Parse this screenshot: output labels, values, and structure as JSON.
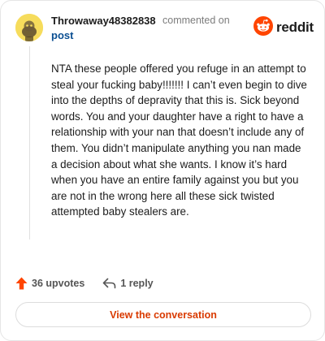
{
  "comment": {
    "author": "Throwaway48382838",
    "action_text": "commented on",
    "target_link": "post",
    "body": "NTA these people offered you refuge in an attempt to steal your fucking baby!!!!!!! I can’t even begin to dive into the depths of depravity that this is. Sick beyond words. You and your daughter have a right to have a relationship with your nan that doesn’t include any of them. You didn’t manipulate anything you nan made a decision about what she wants. I know it’s hard when you have an entire family against you but you are not in the wrong here all these sick twisted attempted baby stealers are.",
    "upvotes_label": "36 upvotes",
    "replies_label": "1 reply"
  },
  "brand": {
    "name": "reddit",
    "accent_color": "#ff4500",
    "icon": "reddit-logo-icon"
  },
  "cta": {
    "label": "View the conversation",
    "color": "#d93a00"
  },
  "icons": {
    "upvote": "upvote-arrow-icon",
    "reply": "reply-arrow-icon",
    "avatar": "snoo-avatar-icon"
  }
}
